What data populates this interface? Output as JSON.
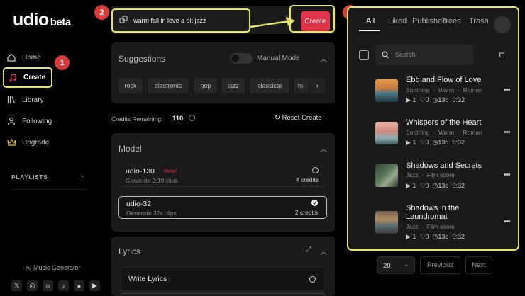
{
  "brand": {
    "name": "udio",
    "suffix": "beta"
  },
  "nav": [
    {
      "label": "Home",
      "icon": "home-icon"
    },
    {
      "label": "Create",
      "icon": "music-note-icon"
    },
    {
      "label": "Library",
      "icon": "library-icon"
    },
    {
      "label": "Following",
      "icon": "user-icon"
    },
    {
      "label": "Upgrade",
      "icon": "crown-icon"
    }
  ],
  "playlists_label": "PLAYLISTS",
  "ai_label": "AI Music Generator",
  "social": [
    "twitter-icon",
    "instagram-icon",
    "discord-icon",
    "tiktok-icon",
    "reddit-icon",
    "youtube-icon"
  ],
  "markers": [
    "1",
    "2",
    "3"
  ],
  "prompt": {
    "value": "warm fall in love a bit jazz",
    "create_label": "Create"
  },
  "suggestions": {
    "title": "Suggestions",
    "manual_mode": "Manual Mode",
    "chips": [
      "rock",
      "electronic",
      "pop",
      "jazz",
      "classical",
      "hi"
    ]
  },
  "credits": {
    "label": "Credits Remaining:",
    "value": "110",
    "reset_label": "Reset Create"
  },
  "model": {
    "title": "Model",
    "options": [
      {
        "name": "udio-130",
        "badge": "New!",
        "sub": "Generate 2:10 clips",
        "credits": "4 credits",
        "selected": false
      },
      {
        "name": "udio-32",
        "badge": "",
        "sub": "Generate 32s clips",
        "credits": "2 credits",
        "selected": true
      }
    ]
  },
  "lyrics": {
    "title": "Lyrics",
    "write_label": "Write Lyrics"
  },
  "library": {
    "tabs": [
      "All",
      "Liked",
      "Published",
      "Trees",
      "Trash"
    ],
    "search_placeholder": "Search",
    "songs": [
      {
        "title": "Ebb and Flow of Love",
        "tags": [
          "Soothing",
          "Warm",
          "Roman"
        ],
        "plays": "1",
        "likes": "0",
        "age": "13d",
        "duration": "0:32"
      },
      {
        "title": "Whispers of the Heart",
        "tags": [
          "Soothing",
          "Warm",
          "Roman"
        ],
        "plays": "1",
        "likes": "0",
        "age": "13d",
        "duration": "0:32"
      },
      {
        "title": "Shadows and Secrets",
        "tags": [
          "Jazz",
          "Film score"
        ],
        "plays": "1",
        "likes": "0",
        "age": "13d",
        "duration": "0:32"
      },
      {
        "title": "Shadows in the Laundromat",
        "tags": [
          "Jazz",
          "Film score"
        ],
        "plays": "1",
        "likes": "0",
        "age": "13d",
        "duration": "0:32"
      }
    ],
    "page_size": "20",
    "prev_label": "Previous",
    "next_label": "Next"
  },
  "colors": {
    "accent": "#e0334a",
    "highlight": "#e8e36a",
    "marker": "#d93b3b"
  }
}
